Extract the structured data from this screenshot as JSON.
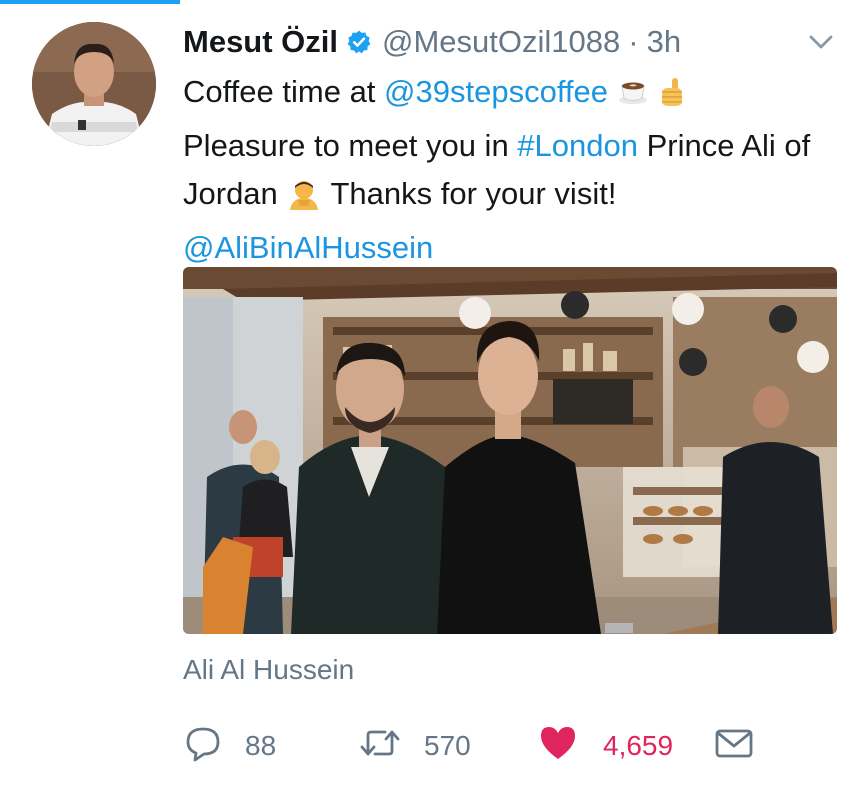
{
  "tweet": {
    "display_name": "Mesut Özil",
    "handle": "@MesutOzil1088",
    "separator": "·",
    "time": "3h",
    "verified": true,
    "text": {
      "part1": "Coffee time at ",
      "mention_coffee": "@39stepscoffee",
      "part2": "Pleasure to meet you in ",
      "hashtag": "#London",
      "part3": " Prince Ali of Jordan ",
      "part4": " Thanks for your visit! ",
      "mention_ali": "@AliBinAlHussein"
    },
    "media_tagged": "Ali Al Hussein"
  },
  "actions": {
    "replies": "88",
    "retweets": "570",
    "likes": "4,659"
  },
  "colors": {
    "link": "#1b95e0",
    "muted": "#657786",
    "like": "#e0245e",
    "verified": "#1da1f2"
  },
  "icons": [
    "verified-badge-icon",
    "chevron-down-icon",
    "coffee-emoji-icon",
    "thumbs-up-emoji-icon",
    "person-bowing-emoji-icon",
    "reply-icon",
    "retweet-icon",
    "heart-icon",
    "envelope-icon"
  ]
}
